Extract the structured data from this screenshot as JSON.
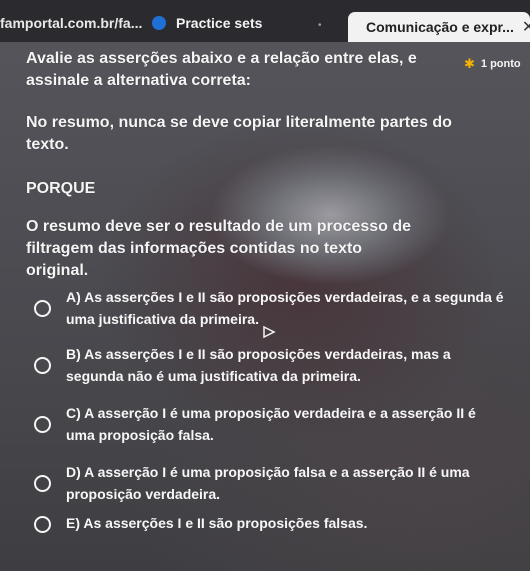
{
  "tabs": {
    "url_tab": "famportal.com.br/fa...",
    "practice_tab": "Practice sets",
    "active_tab": "Comunicação e expr...",
    "icons": [
      "document-icon",
      "close-icon"
    ]
  },
  "question": {
    "points": "1 ponto",
    "instruction": "Avalie as asserções abaixo e a relação entre elas, e assinale a alternativa correta:",
    "assertion": "No resumo, nunca se deve copiar literalmente partes do texto.",
    "connector": "PORQUE",
    "reason": "O resumo deve ser o resultado de um processo de filtragem das informações contidas no texto original."
  },
  "options": [
    {
      "text": "A) As asserções I e II são proposições verdadeiras, e a segunda é uma justificativa da primeira."
    },
    {
      "text": "B) As asserções I e II são proposições verdadeiras, mas a segunda não é uma justificativa da primeira."
    },
    {
      "text": "C) A asserção I é uma proposição verdadeira e a asserção II é uma proposição falsa."
    },
    {
      "text": "D) A asserção I é uma proposição falsa e a asserção II é uma proposição verdadeira."
    },
    {
      "text": "E) As asserções I e II são proposições falsas."
    }
  ]
}
